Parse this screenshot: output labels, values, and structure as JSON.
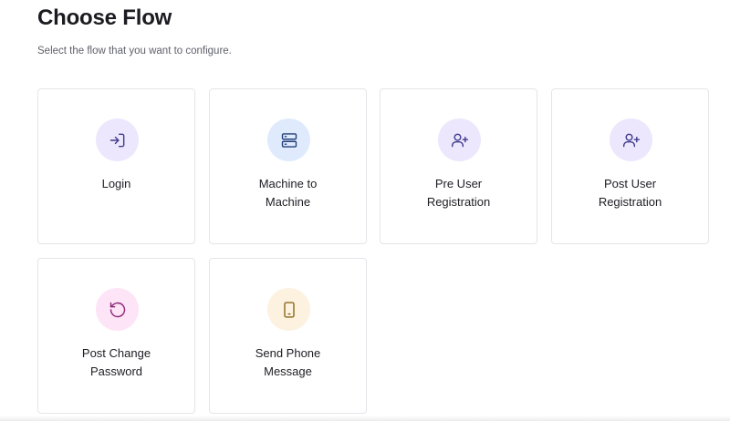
{
  "header": {
    "title": "Choose Flow",
    "subtitle": "Select the flow that you want to configure."
  },
  "flows": [
    {
      "id": "login",
      "line1": "Login",
      "line2": "",
      "icon": "login-arrow-icon",
      "badge_color": "#ece7fd",
      "icon_color": "#3f3a8c"
    },
    {
      "id": "machine-to-machine",
      "line1": "Machine to",
      "line2": "Machine",
      "icon": "server-icon",
      "badge_color": "#dfebfd",
      "icon_color": "#24407a"
    },
    {
      "id": "pre-user-registration",
      "line1": "Pre User",
      "line2": "Registration",
      "icon": "user-add-icon",
      "badge_color": "#ece7fd",
      "icon_color": "#3f3a8c"
    },
    {
      "id": "post-user-registration",
      "line1": "Post User",
      "line2": "Registration",
      "icon": "user-add-icon",
      "badge_color": "#ece7fd",
      "icon_color": "#3f3a8c"
    },
    {
      "id": "post-change-password",
      "line1": "Post Change",
      "line2": "Password",
      "icon": "rotate-ccw-icon",
      "badge_color": "#fde4f6",
      "icon_color": "#8e2a78"
    },
    {
      "id": "send-phone-message",
      "line1": "Send Phone",
      "line2": "Message",
      "icon": "phone-icon",
      "badge_color": "#fcf2df",
      "icon_color": "#8a6a1c"
    }
  ]
}
